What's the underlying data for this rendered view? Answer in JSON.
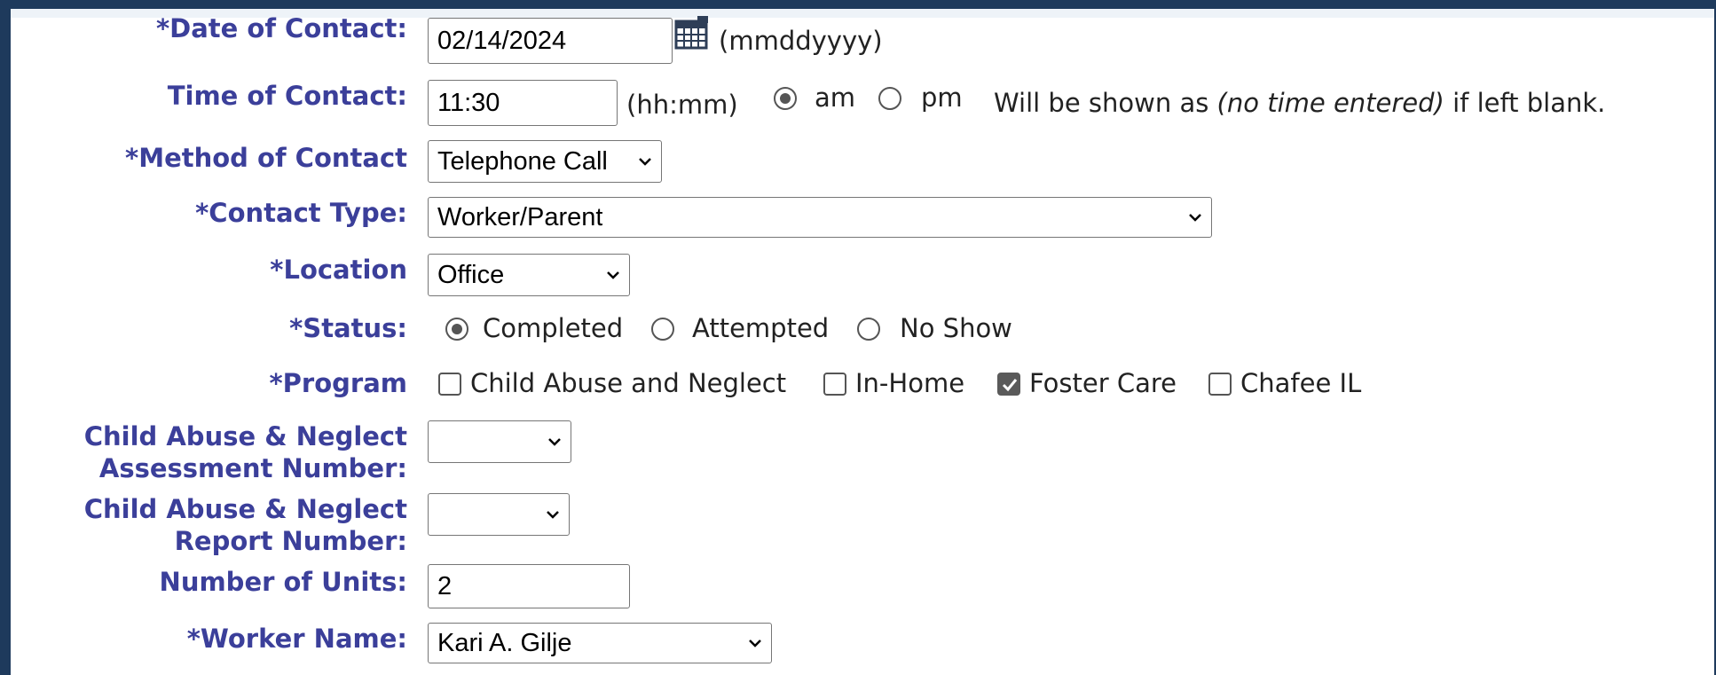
{
  "fields": {
    "date": {
      "label": "*Date of Contact:",
      "value": "02/14/2024",
      "hint": "(mmddyyyy)"
    },
    "time": {
      "label": "Time of Contact:",
      "value": "11:30",
      "hint": "(hh:mm)",
      "am_label": "am",
      "pm_label": "pm",
      "selected": "am",
      "note_prefix": "Will be shown as ",
      "note_em": "(no time entered)",
      "note_suffix": " if left blank."
    },
    "method": {
      "label": "*Method of Contact",
      "value": "Telephone Call"
    },
    "contact_type": {
      "label": "*Contact Type:",
      "value": "Worker/Parent"
    },
    "location": {
      "label": "*Location",
      "value": "Office"
    },
    "status": {
      "label": "*Status:",
      "options": [
        "Completed",
        "Attempted",
        "No Show"
      ],
      "selected": "Completed"
    },
    "program": {
      "label": "*Program",
      "options": [
        "Child Abuse and Neglect",
        "In-Home",
        "Foster Care",
        "Chafee IL"
      ],
      "checked": [
        "Foster Care"
      ]
    },
    "assessment_number": {
      "label": "Child Abuse & Neglect Assessment Number:",
      "value": ""
    },
    "report_number": {
      "label": "Child Abuse & Neglect Report Number:",
      "value": ""
    },
    "units": {
      "label": "Number of Units:",
      "value": "2"
    },
    "worker": {
      "label": "*Worker Name:",
      "value": "Kari A. Gilje"
    }
  },
  "colors": {
    "label": "#3b3f9a",
    "frame": "#1e3a5c"
  },
  "icons": {
    "calendar": "calendar-icon",
    "dropdown": "chevron-down-icon"
  }
}
